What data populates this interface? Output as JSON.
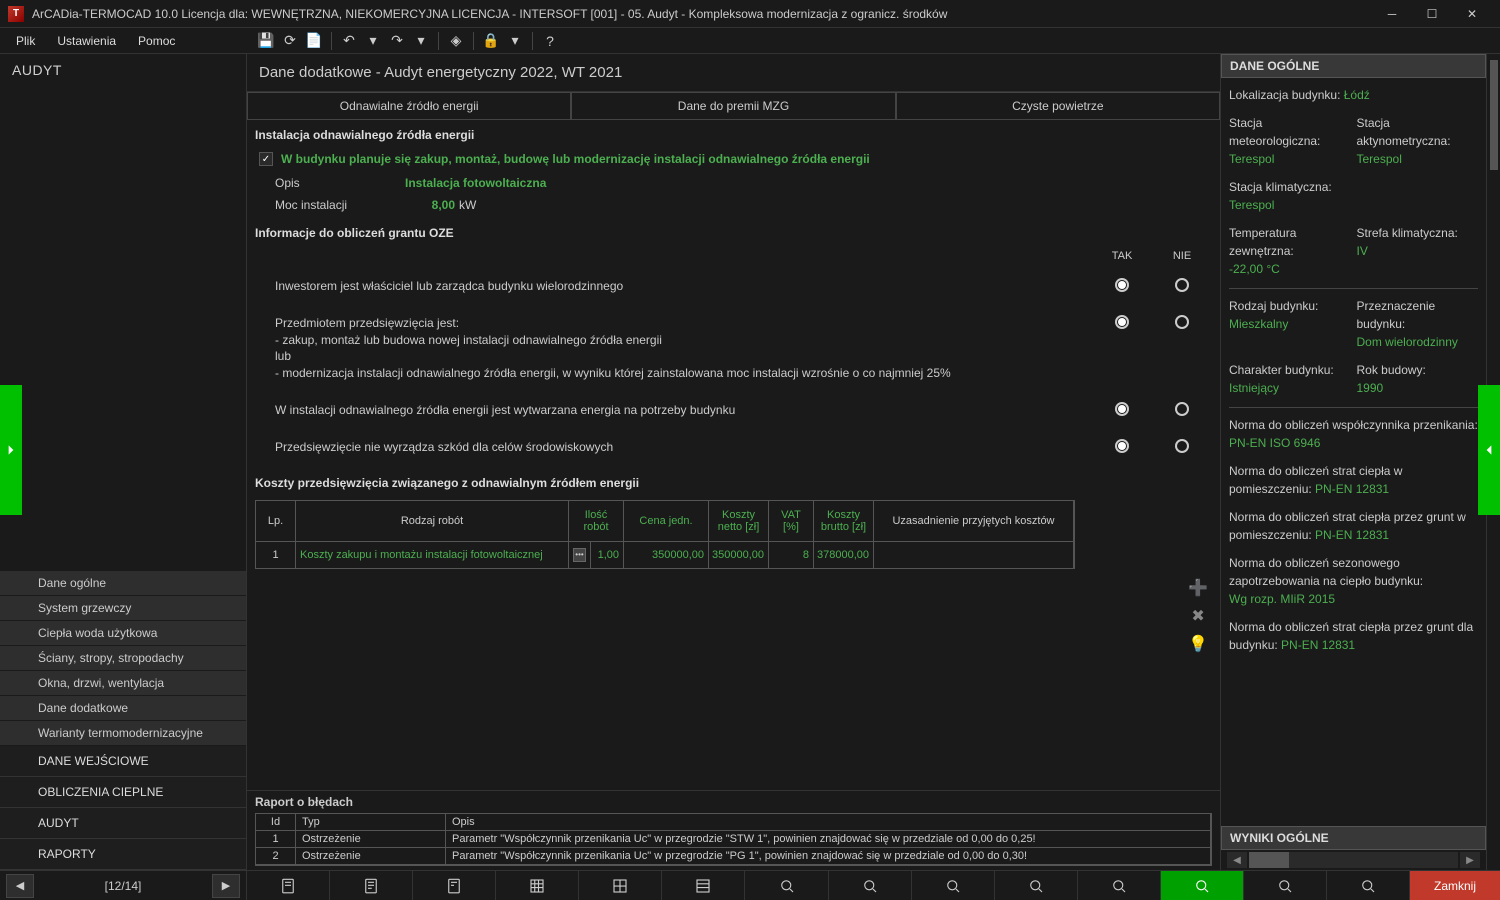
{
  "title": "ArCADia-TERMOCAD 10.0 Licencja dla: WEWNĘTRZNA, NIEKOMERCYJNA LICENCJA - INTERSOFT [001] - 05. Audyt - Kompleksowa modernizacja z ogranicz. środków",
  "menu": {
    "file": "Plik",
    "settings": "Ustawienia",
    "help": "Pomoc"
  },
  "module": "AUDYT",
  "page_head": "Dane dodatkowe - Audyt energetyczny 2022, WT 2021",
  "tabs": {
    "t1": "Odnawialne źródło energii",
    "t2": "Dane do premii MZG",
    "t3": "Czyste powietrze"
  },
  "section1": "Instalacja odnawialnego źródła energii",
  "chk_label": "W budynku planuje się zakup, montaż, budowę lub modernizację instalacji odnawialnego źródła energii",
  "opis": {
    "label": "Opis",
    "value": "Instalacja fotowoltaiczna"
  },
  "moc": {
    "label": "Moc instalacji",
    "value": "8,00",
    "unit": "kW"
  },
  "grant_head": "Informacje do obliczeń grantu OZE",
  "col_tak": "TAK",
  "col_nie": "NIE",
  "q1": "Inwestorem jest właściciel lub zarządca budynku wielorodzinnego",
  "q2a": "Przedmiotem przedsięwzięcia jest:",
  "q2b": "- zakup, montaż lub budowa nowej instalacji odnawialnego źródła energii",
  "q2c": "   lub",
  "q2d": "- modernizacja instalacji odnawialnego źródła energii, w wyniku której zainstalowana moc instalacji wzrośnie o co najmniej 25%",
  "q3": "W instalacji odnawialnego źródła energii jest wytwarzana energia na potrzeby budynku",
  "q4": "Przedsięwzięcie nie wyrządza szkód dla celów środowiskowych",
  "koszty_head": "Koszty przedsięwzięcia związanego z odnawialnym źródłem energii",
  "th": {
    "lp": "Lp.",
    "rodzaj": "Rodzaj robót",
    "ilosc": "Ilość robót",
    "cena": "Cena jedn.",
    "netto": "Koszty netto [zł]",
    "vat": "VAT [%]",
    "brutto": "Koszty brutto [zł]",
    "uzas": "Uzasadnienie przyjętych kosztów"
  },
  "row1": {
    "lp": "1",
    "name": "Koszty zakupu i montażu instalacji fotowoltaicznej",
    "ilosc": "1,00",
    "cena": "350000,00",
    "netto": "350000,00",
    "vat": "8",
    "brutto": "378000,00",
    "uzas": ""
  },
  "nav": {
    "dane_ogolne": "Dane ogólne",
    "system": "System grzewczy",
    "cwu": "Ciepła woda użytkowa",
    "sciany": "Ściany, stropy, stropodachy",
    "okna": "Okna, drzwi, wentylacja",
    "dane_dod": "Dane dodatkowe",
    "warianty": "Warianty termomodernizacyjne",
    "cat1": "DANE WEJŚCIOWE",
    "cat2": "OBLICZENIA CIEPLNE",
    "cat3": "AUDYT",
    "cat4": "RAPORTY"
  },
  "report": {
    "title": "Raport o błędach",
    "h_id": "Id",
    "h_type": "Typ",
    "h_desc": "Opis",
    "r1_id": "1",
    "r1_type": "Ostrzeżenie",
    "r1_desc": "Parametr \"Współczynnik przenikania Uc\" w przegrodzie \"STW 1\", powinien znajdować się w przedziale od 0,00 do 0,25!",
    "r2_id": "2",
    "r2_type": "Ostrzeżenie",
    "r2_desc": "Parametr \"Współczynnik przenikania Uc\" w przegrodzie \"PG 1\", powinien znajdować się w przedziale od 0,00 do 0,30!"
  },
  "right": {
    "panel1": "DANE OGÓLNE",
    "panel2": "WYNIKI OGÓLNE",
    "lokal_l": "Lokalizacja budynku:",
    "lokal_v": "Łódź",
    "meteo_l": "Stacja meteorologiczna:",
    "meteo_v": "Terespol",
    "akty_l": "Stacja aktynometryczna:",
    "akty_v": "Terespol",
    "klim_l": "Stacja klimatyczna:",
    "klim_v": "Terespol",
    "temp_l": "Temperatura zewnętrzna:",
    "temp_v": "-22,00 °C",
    "strefa_l": "Strefa klimatyczna:",
    "strefa_v": "IV",
    "rodzaj_l": "Rodzaj budynku:",
    "rodzaj_v": "Mieszkalny",
    "przezn_l": "Przeznaczenie budynku:",
    "przezn_v": "Dom wielorodzinny",
    "char_l": "Charakter budynku:",
    "char_v": "Istniejący",
    "rok_l": "Rok budowy:",
    "rok_v": "1990",
    "n1_l": "Norma do obliczeń współczynnika przenikania: ",
    "n1_v": "PN-EN ISO 6946",
    "n2_l": "Norma do obliczeń strat ciepła w pomieszczeniu: ",
    "n2_v": "PN-EN 12831",
    "n3_l": "Norma do obliczeń strat ciepła przez grunt w pomieszczeniu: ",
    "n3_v": "PN-EN 12831",
    "n4_l": "Norma do obliczeń sezonowego zapotrzebowania na ciepło budynku: ",
    "n4_v": "Wg rozp. MIiR 2015",
    "n5_l": "Norma do obliczeń strat ciepła przez grunt dla budynku: ",
    "n5_v": "PN-EN 12831"
  },
  "pager": "[12/14]",
  "close": "Zamknij"
}
